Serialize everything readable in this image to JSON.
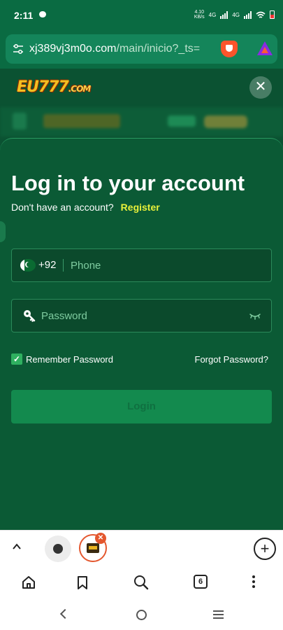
{
  "status": {
    "time": "2:11",
    "net_speed_value": "4.10",
    "net_speed_unit": "KB/s",
    "net1": "4G",
    "net2": "4G"
  },
  "browser": {
    "url_host": "xj389vj3m0o.com",
    "url_path": "/main/inicio?_ts="
  },
  "site": {
    "logo_main": "EU777",
    "logo_suffix": ".COM",
    "close": "✕"
  },
  "login": {
    "title": "Log in to your account",
    "no_account": "Don't have an account?",
    "register": "Register",
    "country_code": "+92",
    "phone_placeholder": "Phone",
    "password_placeholder": "Password",
    "remember": "Remember Password",
    "forgot": "Forgot Password?",
    "submit": "Login"
  },
  "bottom": {
    "tabs_count": "6",
    "tab_close": "✕",
    "new_tab": "+"
  },
  "colors": {
    "brand_green": "#0b5a35",
    "accent_yellow": "#e8f03a",
    "brave_orange": "#fb542b"
  }
}
